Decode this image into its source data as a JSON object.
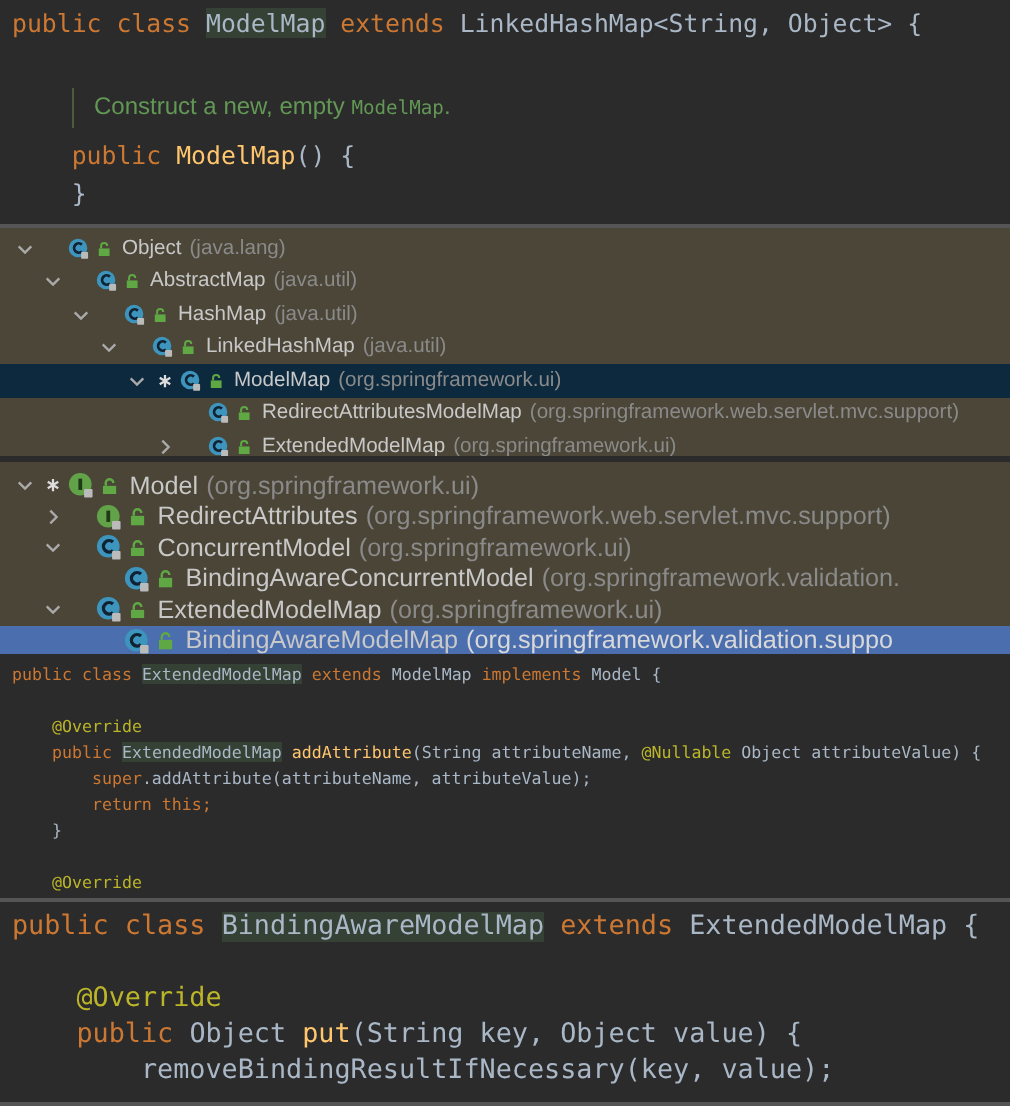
{
  "panels": [
    {
      "kind": "code",
      "lines": [
        {
          "kind": "code",
          "tokens": [
            {
              "kind": "kw",
              "s": "public class "
            },
            {
              "kind": "hl",
              "s": "ModelMap"
            },
            {
              "kind": "kw",
              "s": " extends "
            },
            {
              "kind": "plain",
              "s": "LinkedHashMap<String, Object> {"
            }
          ]
        },
        {
          "kind": "blank"
        },
        {
          "kind": "doc",
          "tokens": [
            {
              "kind": "doc",
              "s": "Construct a new, empty "
            },
            {
              "kind": "doccode",
              "s": "ModelMap"
            },
            {
              "kind": "doc",
              "s": "."
            }
          ]
        },
        {
          "kind": "code",
          "tokens": [
            {
              "kind": "kw",
              "s": "    public "
            },
            {
              "kind": "method",
              "s": "ModelMap"
            },
            {
              "kind": "plain",
              "s": "() {"
            }
          ]
        },
        {
          "kind": "code",
          "tokens": [
            {
              "kind": "plain",
              "s": "    }"
            }
          ]
        }
      ]
    },
    {
      "kind": "tree",
      "focused": false,
      "nodes": [
        {
          "name": "Object",
          "package": "(java.lang)",
          "kind": "class",
          "starred": false,
          "expanded": true,
          "selected": false,
          "children": [
            {
              "name": "AbstractMap",
              "package": "(java.util)",
              "kind": "class",
              "starred": false,
              "expanded": true,
              "selected": false,
              "children": [
                {
                  "name": "HashMap",
                  "package": "(java.util)",
                  "kind": "class",
                  "starred": false,
                  "expanded": true,
                  "selected": false,
                  "children": [
                    {
                      "name": "LinkedHashMap",
                      "package": "(java.util)",
                      "kind": "class",
                      "starred": false,
                      "expanded": true,
                      "selected": false,
                      "children": [
                        {
                          "name": "ModelMap",
                          "package": "(org.springframework.ui)",
                          "kind": "class",
                          "starred": true,
                          "expanded": true,
                          "selected": true,
                          "children": [
                            {
                              "name": "RedirectAttributesModelMap",
                              "package": "(org.springframework.web.servlet.mvc.support)",
                              "kind": "class",
                              "starred": false,
                              "selected": false
                            },
                            {
                              "name": "ExtendedModelMap",
                              "package": "(org.springframework.ui)",
                              "kind": "class",
                              "starred": false,
                              "expanded": false,
                              "selected": false
                            }
                          ]
                        }
                      ]
                    }
                  ]
                }
              ]
            }
          ]
        }
      ]
    },
    {
      "kind": "tree",
      "focused": true,
      "nodes": [
        {
          "name": "Model",
          "package": "(org.springframework.ui)",
          "kind": "interface",
          "starred": true,
          "expanded": true,
          "selected": false,
          "children": [
            {
              "name": "RedirectAttributes",
              "package": "(org.springframework.web.servlet.mvc.support)",
              "kind": "interface",
              "starred": false,
              "expanded": false,
              "selected": false
            },
            {
              "name": "ConcurrentModel",
              "package": "(org.springframework.ui)",
              "kind": "class",
              "starred": false,
              "expanded": true,
              "selected": false,
              "children": [
                {
                  "name": "BindingAwareConcurrentModel",
                  "package": "(org.springframework.validation.",
                  "kind": "class",
                  "starred": false,
                  "selected": false
                }
              ]
            },
            {
              "name": "ExtendedModelMap",
              "package": "(org.springframework.ui)",
              "kind": "class",
              "starred": false,
              "expanded": true,
              "selected": false,
              "children": [
                {
                  "name": "BindingAwareModelMap",
                  "package": "(org.springframework.validation.suppo",
                  "kind": "class",
                  "starred": false,
                  "selected": true
                }
              ]
            }
          ]
        }
      ]
    },
    {
      "kind": "code",
      "lines": [
        {
          "kind": "code",
          "tokens": [
            {
              "kind": "kw",
              "s": "public class "
            },
            {
              "kind": "hl",
              "s": "ExtendedModelMap"
            },
            {
              "kind": "kw",
              "s": " extends "
            },
            {
              "kind": "plain",
              "s": "ModelMap "
            },
            {
              "kind": "kw",
              "s": "implements "
            },
            {
              "kind": "plain",
              "s": "Model {"
            }
          ]
        },
        {
          "kind": "blank"
        },
        {
          "kind": "code",
          "tokens": [
            {
              "kind": "ann",
              "s": "    @Override"
            }
          ]
        },
        {
          "kind": "code",
          "tokens": [
            {
              "kind": "kw",
              "s": "    public "
            },
            {
              "kind": "hl",
              "s": "ExtendedModelMap"
            },
            {
              "kind": "method",
              "s": " addAttribute"
            },
            {
              "kind": "plain",
              "s": "(String attributeName, "
            },
            {
              "kind": "ann",
              "s": "@Nullable"
            },
            {
              "kind": "plain",
              "s": " Object attributeValue) {"
            }
          ]
        },
        {
          "kind": "code",
          "tokens": [
            {
              "kind": "kw",
              "s": "        super"
            },
            {
              "kind": "plain",
              "s": ".addAttribute(attributeName, attributeValue);"
            }
          ]
        },
        {
          "kind": "code",
          "tokens": [
            {
              "kind": "kw",
              "s": "        return this;"
            }
          ]
        },
        {
          "kind": "code",
          "tokens": [
            {
              "kind": "plain",
              "s": "    }"
            }
          ]
        },
        {
          "kind": "blank"
        },
        {
          "kind": "code",
          "tokens": [
            {
              "kind": "ann",
              "s": "    @Override"
            }
          ]
        }
      ]
    },
    {
      "kind": "code",
      "lines": [
        {
          "kind": "code",
          "tokens": [
            {
              "kind": "kw",
              "s": "public class "
            },
            {
              "kind": "hl",
              "s": "BindingAwareModelMap"
            },
            {
              "kind": "kw",
              "s": " extends "
            },
            {
              "kind": "plain",
              "s": "ExtendedModelMap {"
            }
          ]
        },
        {
          "kind": "blank"
        },
        {
          "kind": "code",
          "tokens": [
            {
              "kind": "ann",
              "s": "    @Override"
            }
          ]
        },
        {
          "kind": "code",
          "tokens": [
            {
              "kind": "kw",
              "s": "    public "
            },
            {
              "kind": "plain",
              "s": "Object "
            },
            {
              "kind": "method",
              "s": "put"
            },
            {
              "kind": "plain",
              "s": "(String key, Object value) {"
            }
          ]
        },
        {
          "kind": "code",
          "tokens": [
            {
              "kind": "plain",
              "s": "        removeBindingResultIfNecessary(key, value);"
            }
          ]
        }
      ]
    }
  ]
}
